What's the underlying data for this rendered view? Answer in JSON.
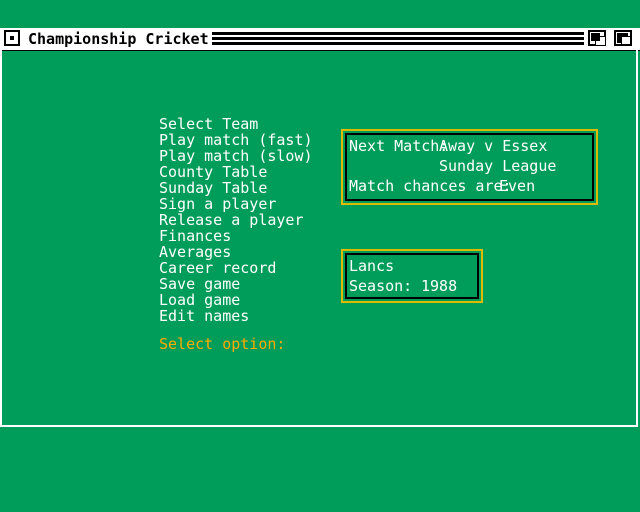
{
  "window": {
    "title": "Championship Cricket"
  },
  "menu": {
    "items": [
      "Select Team",
      "Play match (fast)",
      "Play match (slow)",
      "County Table",
      "Sunday Table",
      "Sign a player",
      "Release a player",
      "Finances",
      "Averages",
      "Career record",
      "Save game",
      "Load game",
      "Edit names"
    ],
    "prompt": "Select option:"
  },
  "next_match": {
    "label": "Next Match:",
    "fixture": "Away v Essex",
    "competition": "Sunday League",
    "chances_label": "Match chances are:",
    "chances_value": "Even"
  },
  "team_info": {
    "team": "Lancs",
    "season_label": "Season:",
    "season": "1988"
  },
  "colors": {
    "background": "#009c5a",
    "menu_text": "#ffffff",
    "prompt_text": "#ffaa00",
    "box_border": "#ddbb00"
  }
}
